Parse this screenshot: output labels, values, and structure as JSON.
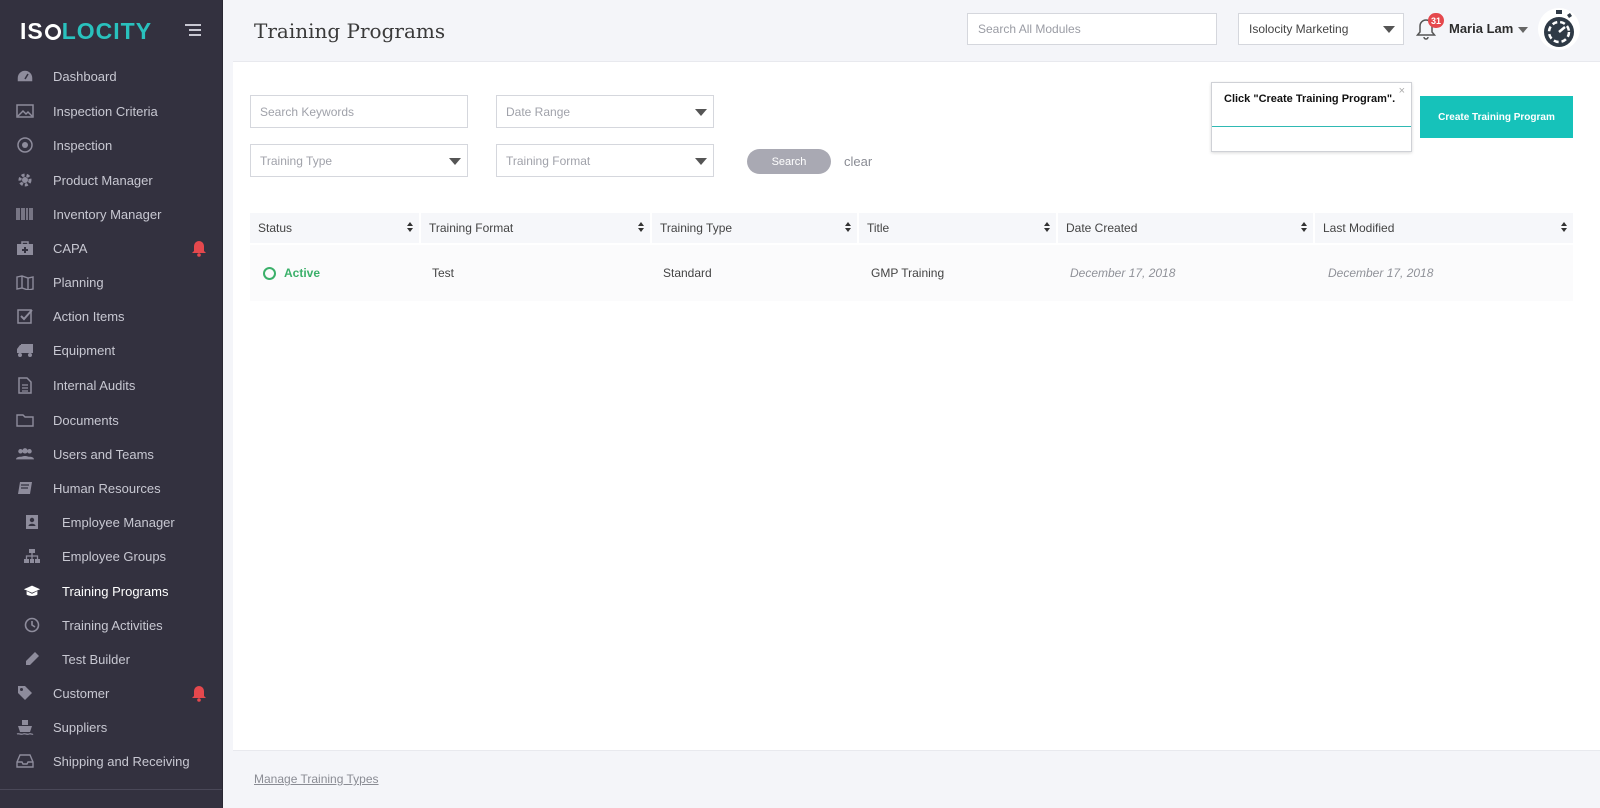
{
  "app": {
    "logo_part1": "IS",
    "logo_part2": "LOCITY",
    "page_title": "Training Programs"
  },
  "header": {
    "search_placeholder": "Search All Modules",
    "company": "Isolocity Marketing",
    "notification_count": "31",
    "user_name": "Maria Lam"
  },
  "sidebar": {
    "items": [
      {
        "label": "Dashboard",
        "icon": "dashboard-icon"
      },
      {
        "label": "Inspection Criteria",
        "icon": "image-icon"
      },
      {
        "label": "Inspection",
        "icon": "target-icon"
      },
      {
        "label": "Product Manager",
        "icon": "gear-icon"
      },
      {
        "label": "Inventory Manager",
        "icon": "barcode-icon"
      },
      {
        "label": "CAPA",
        "icon": "medkit-icon",
        "alert": true
      },
      {
        "label": "Planning",
        "icon": "map-icon"
      },
      {
        "label": "Action Items",
        "icon": "checkbox-icon"
      },
      {
        "label": "Equipment",
        "icon": "truck-icon"
      },
      {
        "label": "Internal Audits",
        "icon": "document-icon"
      },
      {
        "label": "Documents",
        "icon": "folder-icon"
      },
      {
        "label": "Users and Teams",
        "icon": "users-icon"
      },
      {
        "label": "Human Resources",
        "icon": "book-icon"
      },
      {
        "label": "Employee Manager",
        "icon": "id-badge-icon",
        "sub": true
      },
      {
        "label": "Employee Groups",
        "icon": "sitemap-icon",
        "sub": true
      },
      {
        "label": "Training Programs",
        "icon": "graduation-cap-icon",
        "sub": true,
        "active": true
      },
      {
        "label": "Training Activities",
        "icon": "clock-icon",
        "sub": true
      },
      {
        "label": "Test Builder",
        "icon": "pencil-icon",
        "sub": true
      },
      {
        "label": "Customer",
        "icon": "tag-icon",
        "alert": true
      },
      {
        "label": "Suppliers",
        "icon": "ship-icon"
      },
      {
        "label": "Shipping and Receiving",
        "icon": "inbox-icon"
      }
    ]
  },
  "filters": {
    "keywords_placeholder": "Search Keywords",
    "date_range": "Date Range",
    "training_type": "Training Type",
    "training_format": "Training Format",
    "search_label": "Search",
    "clear_label": "clear"
  },
  "tooltip": {
    "text": "Click \"Create Training Program\".",
    "close": "×"
  },
  "create_button": "Create Training Program",
  "table": {
    "columns": [
      "Status",
      "Training Format",
      "Training Type",
      "Title",
      "Date Created",
      "Last Modified"
    ],
    "rows": [
      {
        "status": "Active",
        "format": "Test",
        "type": "Standard",
        "title": "GMP Training",
        "created": "December 17, 2018",
        "modified": "December 17, 2018"
      }
    ]
  },
  "footer": {
    "manage_link": "Manage Training Types"
  },
  "colors": {
    "sidebar_bg": "#33313f",
    "accent": "#16c2ba",
    "status_active": "#3bb06a",
    "alert": "#e5484d"
  }
}
